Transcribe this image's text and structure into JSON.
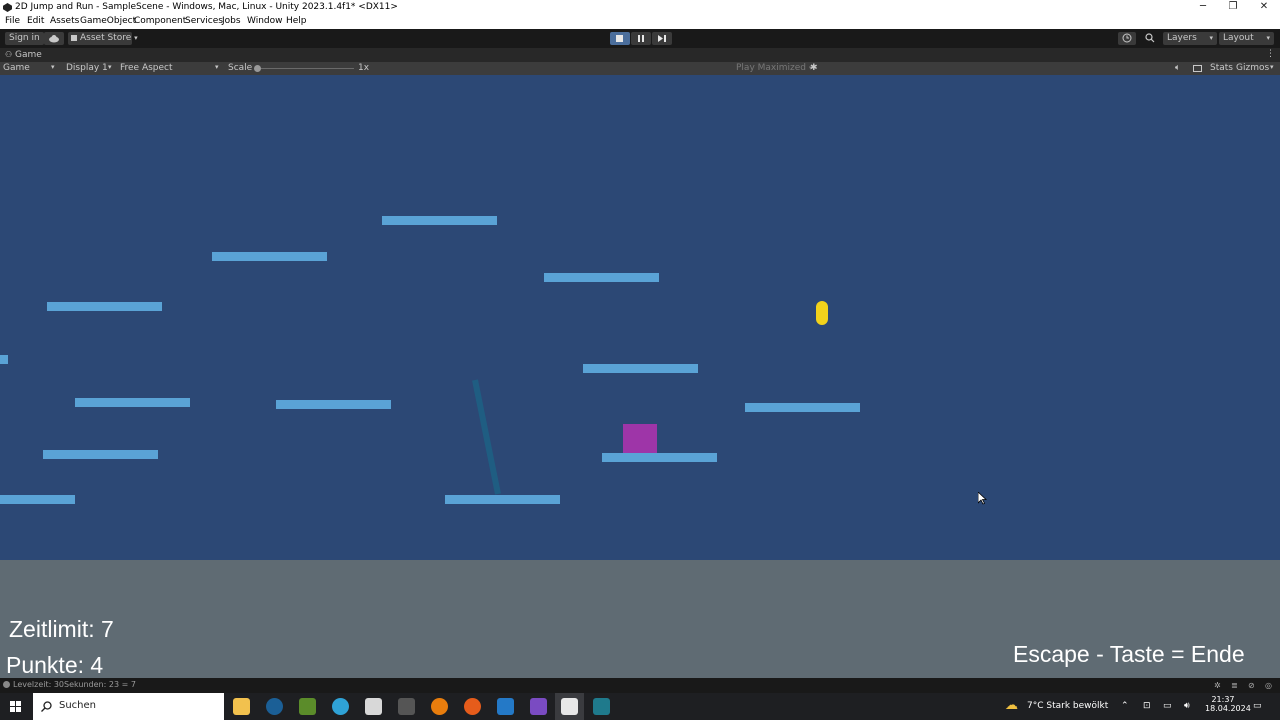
{
  "window": {
    "title": "2D Jump and Run - SampleScene - Windows, Mac, Linux - Unity 2023.1.4f1* <DX11>",
    "minimize": "─",
    "restore": "❐",
    "close": "✕"
  },
  "menu": [
    "File",
    "Edit",
    "Assets",
    "GameObject",
    "Component",
    "Services",
    "Jobs",
    "Window",
    "Help"
  ],
  "toolbar": {
    "sign_in": "Sign in",
    "asset_store": "Asset Store",
    "layers": "Layers",
    "layout": "Layout"
  },
  "game_tab": {
    "label": "Game"
  },
  "game_bar": {
    "view": "Game",
    "display": "Display 1",
    "aspect": "Free Aspect",
    "scale_label": "Scale",
    "scale_value": "1x",
    "play_mode": "Play Maximized",
    "stats": "Stats",
    "gizmos": "Gizmos"
  },
  "hud": {
    "timer": "Zeitlimit: 7",
    "score": "Punkte: 4",
    "exit_hint": "Escape - Taste = Ende"
  },
  "colors": {
    "sky": "#2c4875",
    "platform": "#5aa3d6",
    "player": "#9e35a8",
    "coin": "#f2d21b",
    "hud_bg": "#5f6b73"
  },
  "status": {
    "message": "Levelzeit: 30Sekunden: 23 = 7"
  },
  "taskbar": {
    "search": "Suchen",
    "weather": "7°C  Stark bewölkt",
    "time": "21:37",
    "date": "18.04.2024"
  }
}
